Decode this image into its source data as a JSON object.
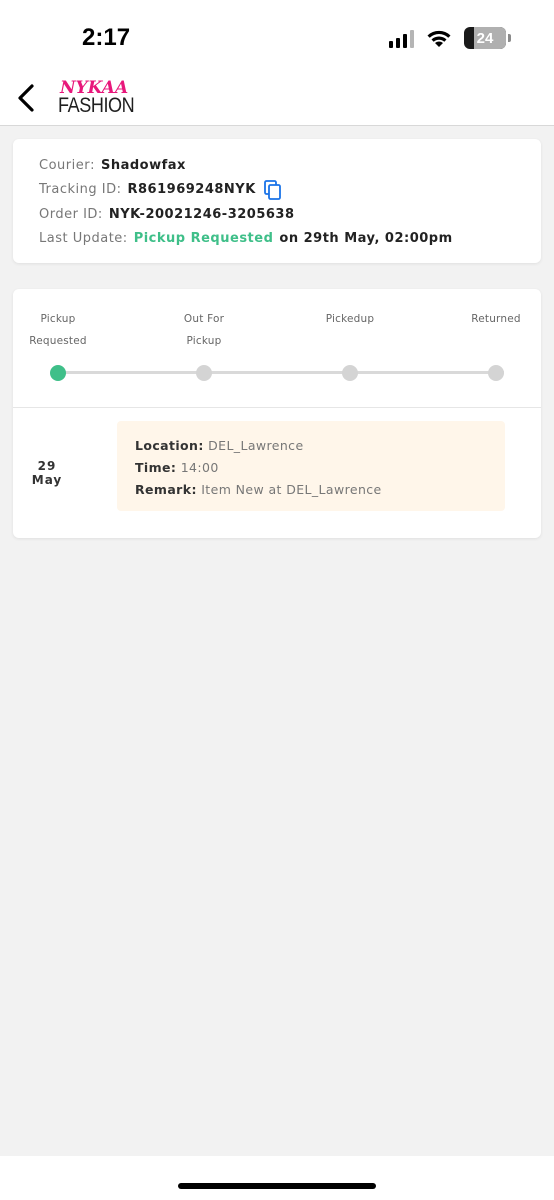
{
  "status_bar": {
    "time": "2:17",
    "battery": "24",
    "battery_level": 0.24
  },
  "header": {
    "logo_top": "NYKAA",
    "logo_bottom": "FASHION",
    "logo_color": "#e8177b"
  },
  "shipment": {
    "courier_label": "Courier",
    "courier": "Shadowfax",
    "tracking_label": "Tracking ID",
    "tracking_id": "R861969248NYK",
    "order_label": "Order ID",
    "order_id": "NYK-20021246-3205638",
    "last_update_label": "Last Update",
    "last_update_status": "Pickup Requested",
    "last_update_time": "on 29th May, 02:00pm"
  },
  "tracker": {
    "steps": [
      {
        "line1": "Pickup",
        "line2": "Requested",
        "active": true
      },
      {
        "line1": "Out For",
        "line2": "Pickup",
        "active": false
      },
      {
        "line1": "Pickedup",
        "line2": "",
        "active": false
      },
      {
        "line1": "Returned",
        "line2": "",
        "active": false
      }
    ],
    "active_color": "#3fbf89"
  },
  "events": [
    {
      "day": "29",
      "month": "May",
      "location_label": "Location:",
      "location": "DEL_Lawrence",
      "time_label": "Time:",
      "time": "14:00",
      "remark_label": "Remark:",
      "remark": "Item New at DEL_Lawrence"
    }
  ]
}
